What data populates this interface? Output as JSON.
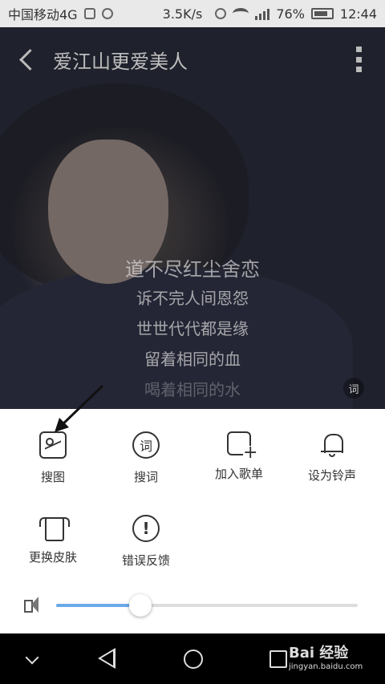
{
  "status_bar": {
    "carrier": "中国移动4G",
    "speed": "3.5K/s",
    "battery": "76%",
    "time": "12:44"
  },
  "player": {
    "title": "爱江山更爱美人",
    "lyrics": [
      "道不尽红尘舍恋",
      "诉不完人间恩怨",
      "世世代代都是缘",
      "留着相同的血",
      "喝着相同的水"
    ],
    "lyrics_badge": "词"
  },
  "menu": {
    "row1": [
      {
        "label": "搜图",
        "icon": "image-icon"
      },
      {
        "label": "搜词",
        "icon": "lyrics-icon",
        "glyph": "词"
      },
      {
        "label": "加入歌单",
        "icon": "add-playlist-icon"
      },
      {
        "label": "设为铃声",
        "icon": "bell-icon"
      }
    ],
    "row2": [
      {
        "label": "更换皮肤",
        "icon": "shirt-icon"
      },
      {
        "label": "错误反馈",
        "icon": "alert-icon",
        "glyph": "!"
      }
    ],
    "volume": {
      "level": 0.28
    }
  },
  "watermark": {
    "main": "Bai 经验",
    "sub": "jingyan.baidu.com"
  },
  "colors": {
    "accent": "#6aa8e8"
  }
}
